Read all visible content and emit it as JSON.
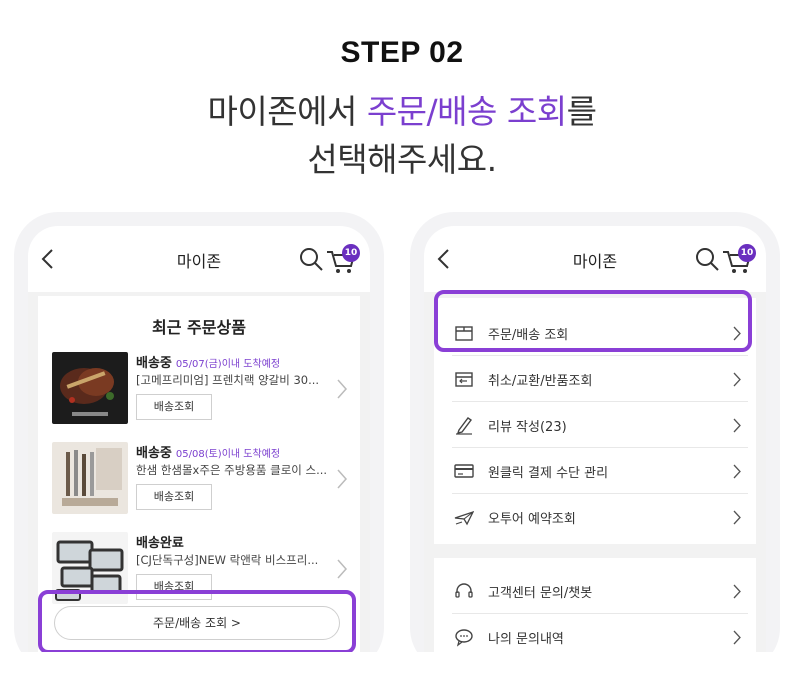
{
  "step": {
    "label": "STEP 02"
  },
  "headline": {
    "line1_pre": "마이존에서 ",
    "line1_accent": "주문/배송 조회",
    "line1_post": "를",
    "line2": "선택해주세요."
  },
  "colors": {
    "accent": "#7b3fcf",
    "highlight": "#35e090",
    "frame": "#8a3fd6"
  },
  "left_phone": {
    "title": "마이존",
    "cart_count": "10",
    "recent_title": "최근 주문상품",
    "orders": [
      {
        "status": "배송중",
        "date": "05/07(금)이내 도착예정",
        "name": "[고메프리미엄] 프렌치랙 양갈비 30...",
        "button": "배송조회"
      },
      {
        "status": "배송중",
        "date": "05/08(토)이내 도착예정",
        "name": "한샘 한샘몰x주은 주방용품 클로이 스...",
        "button": "배송조회"
      },
      {
        "status": "배송완료",
        "date": "",
        "name": "[CJ단독구성]NEW 락앤락 비스프리...",
        "button": "배송조회"
      }
    ],
    "all_orders_button": "주문/배송 조회 >"
  },
  "right_phone": {
    "title": "마이존",
    "cart_count": "10",
    "menu_group1": [
      {
        "label": "주문/배송 조회",
        "icon": "box-icon"
      },
      {
        "label": "취소/교환/반품조회",
        "icon": "return-icon"
      },
      {
        "label": "리뷰 작성(23)",
        "icon": "pen-icon"
      },
      {
        "label": "원클릭 결제 수단 관리",
        "icon": "card-icon"
      },
      {
        "label": "오투어 예약조회",
        "icon": "plane-icon"
      }
    ],
    "menu_group2": [
      {
        "label": "고객센터 문의/챗봇",
        "icon": "headset-icon"
      },
      {
        "label": "나의 문의내역",
        "icon": "chat-icon"
      }
    ]
  }
}
